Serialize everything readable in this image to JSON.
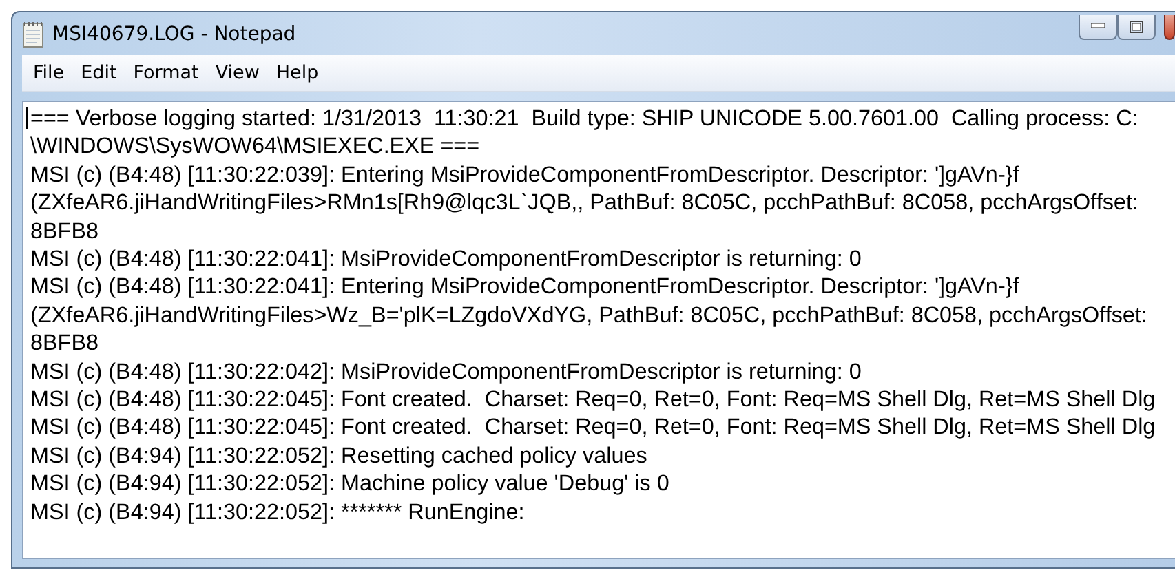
{
  "window": {
    "title": "MSI40679.LOG - Notepad"
  },
  "menu": [
    "File",
    "Edit",
    "Format",
    "View",
    "Help"
  ],
  "lines": [
    "=== Verbose logging started: 1/31/2013  11:30:21  Build type: SHIP UNICODE 5.00.7601.00  Calling process: C:",
    "\\WINDOWS\\SysWOW64\\MSIEXEC.EXE ===",
    "MSI (c) (B4:48) [11:30:22:039]: Entering MsiProvideComponentFromDescriptor. Descriptor: ']gAVn-}f",
    "(ZXfeAR6.jiHandWritingFiles>RMn1s[Rh9@lqc3L`JQB,, PathBuf: 8C05C, pcchPathBuf: 8C058, pcchArgsOffset:",
    "8BFB8",
    "MSI (c) (B4:48) [11:30:22:041]: MsiProvideComponentFromDescriptor is returning: 0",
    "MSI (c) (B4:48) [11:30:22:041]: Entering MsiProvideComponentFromDescriptor. Descriptor: ']gAVn-}f",
    "(ZXfeAR6.jiHandWritingFiles>Wz_B='plK=LZgdoVXdYG, PathBuf: 8C05C, pcchPathBuf: 8C058, pcchArgsOffset:",
    "8BFB8",
    "MSI (c) (B4:48) [11:30:22:042]: MsiProvideComponentFromDescriptor is returning: 0",
    "MSI (c) (B4:48) [11:30:22:045]: Font created.  Charset: Req=0, Ret=0, Font: Req=MS Shell Dlg, Ret=MS Shell Dlg",
    "MSI (c) (B4:48) [11:30:22:045]: Font created.  Charset: Req=0, Ret=0, Font: Req=MS Shell Dlg, Ret=MS Shell Dlg",
    "MSI (c) (B4:94) [11:30:22:052]: Resetting cached policy values",
    "MSI (c) (B4:94) [11:30:22:052]: Machine policy value 'Debug' is 0",
    "MSI (c) (B4:94) [11:30:22:052]: ******* RunEngine:"
  ]
}
